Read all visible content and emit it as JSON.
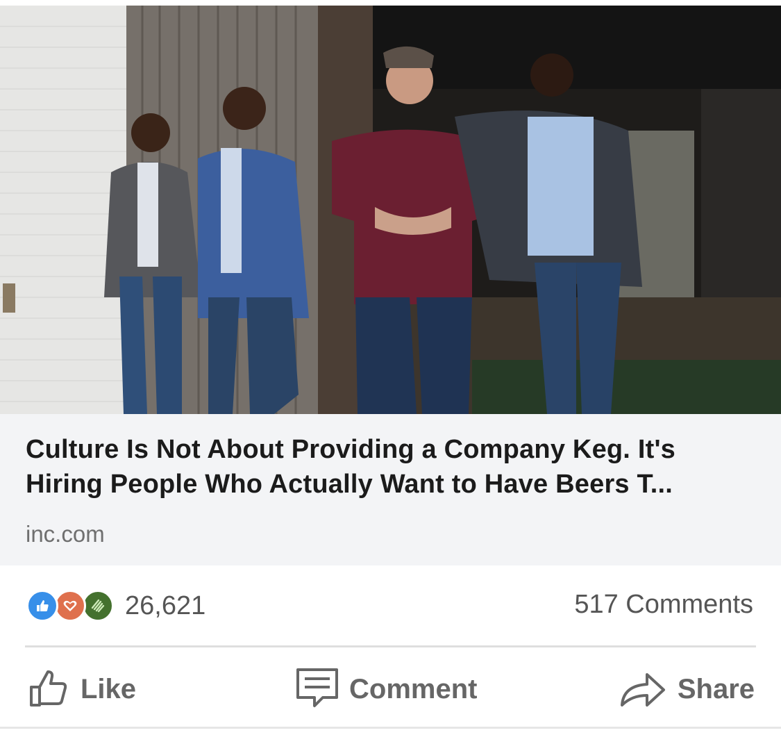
{
  "post": {
    "image": {
      "icon": "photo-four-men-leaning-on-wooden-wall"
    },
    "headline": "Culture Is Not About Providing a Company Keg. It's Hiring People Who Actually Want to Have Beers T...",
    "source": "inc.com"
  },
  "social": {
    "reactions": [
      {
        "name": "like",
        "icon": "thumbs-up-icon",
        "color": "#378fe9"
      },
      {
        "name": "love",
        "icon": "heart-icon",
        "color": "#df704d"
      },
      {
        "name": "celebrate",
        "icon": "clapping-hands-icon",
        "color": "#44712e"
      }
    ],
    "reaction_count": "26,621",
    "comments_count": "517 Comments"
  },
  "actions": {
    "like_label": "Like",
    "comment_label": "Comment",
    "share_label": "Share"
  }
}
